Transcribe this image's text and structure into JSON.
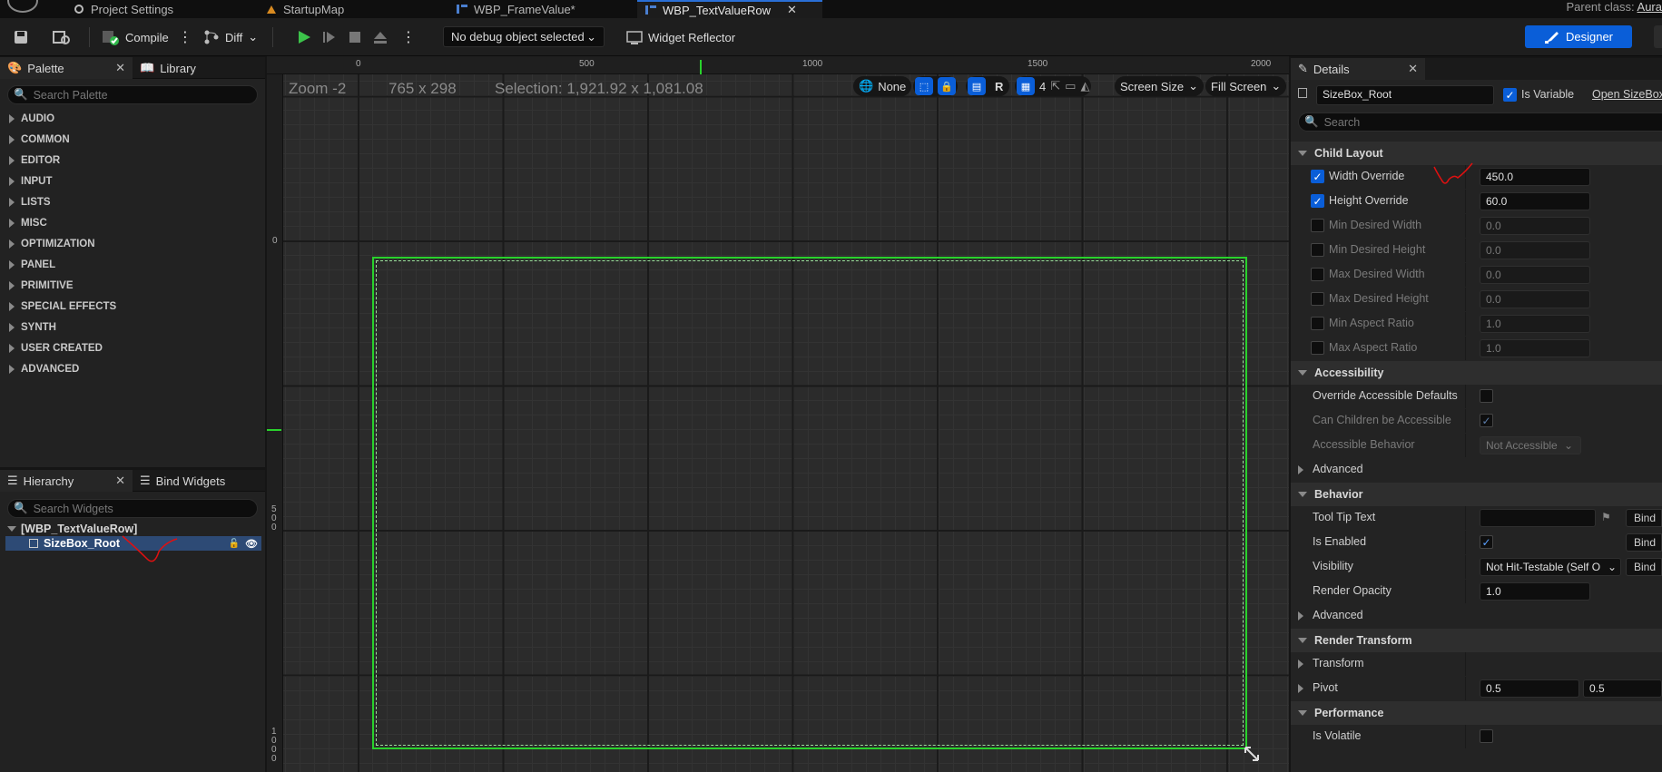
{
  "tabs": [
    {
      "label": "Project Settings",
      "active": false
    },
    {
      "label": "StartupMap",
      "active": false
    },
    {
      "label": "WBP_FrameValue*",
      "active": false
    },
    {
      "label": "WBP_TextValueRow",
      "active": true
    }
  ],
  "parent_class": {
    "label": "Parent class:",
    "value": "Aura"
  },
  "toolbar": {
    "compile_label": "Compile",
    "diff_label": "Diff",
    "debug_select": "No debug object selected",
    "widget_reflector": "Widget Reflector",
    "designer_label": "Designer"
  },
  "palette": {
    "tab_label": "Palette",
    "library_label": "Library",
    "search_placeholder": "Search Palette",
    "categories": [
      "AUDIO",
      "COMMON",
      "EDITOR",
      "INPUT",
      "LISTS",
      "MISC",
      "OPTIMIZATION",
      "PANEL",
      "PRIMITIVE",
      "SPECIAL EFFECTS",
      "SYNTH",
      "USER CREATED",
      "ADVANCED"
    ]
  },
  "hierarchy": {
    "tab_label": "Hierarchy",
    "bind_label": "Bind Widgets",
    "search_placeholder": "Search Widgets",
    "root_label": "[WBP_TextValueRow]",
    "child_label": "SizeBox_Root"
  },
  "viewport": {
    "zoom": "Zoom -2",
    "resolution": "765 x 298",
    "selection": "Selection: 1,921.92 x 1,081.08",
    "ruler_top": [
      "0",
      "500",
      "1000",
      "1500",
      "2000"
    ],
    "ruler_left": [
      "0",
      "5\n0\n0",
      "1\n0\n0\n0"
    ],
    "none_label": "None",
    "r_label": "R",
    "grid_value": "4",
    "screen_size": "Screen Size",
    "fill_screen": "Fill Screen"
  },
  "details": {
    "tab_label": "Details",
    "name_value": "SizeBox_Root",
    "is_variable_label": "Is Variable",
    "open_link": "Open SizeBox",
    "search_placeholder": "Search",
    "sections": {
      "child_layout": "Child Layout",
      "accessibility": "Accessibility",
      "behavior": "Behavior",
      "render_transform": "Render Transform",
      "performance": "Performance"
    },
    "child_layout": {
      "width_override_label": "Width Override",
      "width_override_value": "450.0",
      "height_override_label": "Height Override",
      "height_override_value": "60.0",
      "min_w_label": "Min Desired Width",
      "min_w_value": "0.0",
      "min_h_label": "Min Desired Height",
      "min_h_value": "0.0",
      "max_w_label": "Max Desired Width",
      "max_w_value": "0.0",
      "max_h_label": "Max Desired Height",
      "max_h_value": "0.0",
      "min_ar_label": "Min Aspect Ratio",
      "min_ar_value": "1.0",
      "max_ar_label": "Max Aspect Ratio",
      "max_ar_value": "1.0"
    },
    "accessibility": {
      "override_label": "Override Accessible Defaults",
      "children_label": "Can Children be Accessible",
      "behavior_label": "Accessible Behavior",
      "behavior_value": "Not Accessible",
      "advanced_label": "Advanced"
    },
    "behavior": {
      "tooltip_label": "Tool Tip Text",
      "enabled_label": "Is Enabled",
      "visibility_label": "Visibility",
      "visibility_value": "Not Hit-Testable (Self O",
      "opacity_label": "Render Opacity",
      "opacity_value": "1.0",
      "advanced_label": "Advanced",
      "bind_label": "Bind"
    },
    "render_transform": {
      "transform_label": "Transform",
      "pivot_label": "Pivot",
      "pivot_x": "0.5",
      "pivot_y": "0.5"
    },
    "performance": {
      "volatile_label": "Is Volatile"
    }
  },
  "colors": {
    "accent": "#0a5ed8",
    "selection": "#29d12c",
    "annotation": "#e01010"
  }
}
